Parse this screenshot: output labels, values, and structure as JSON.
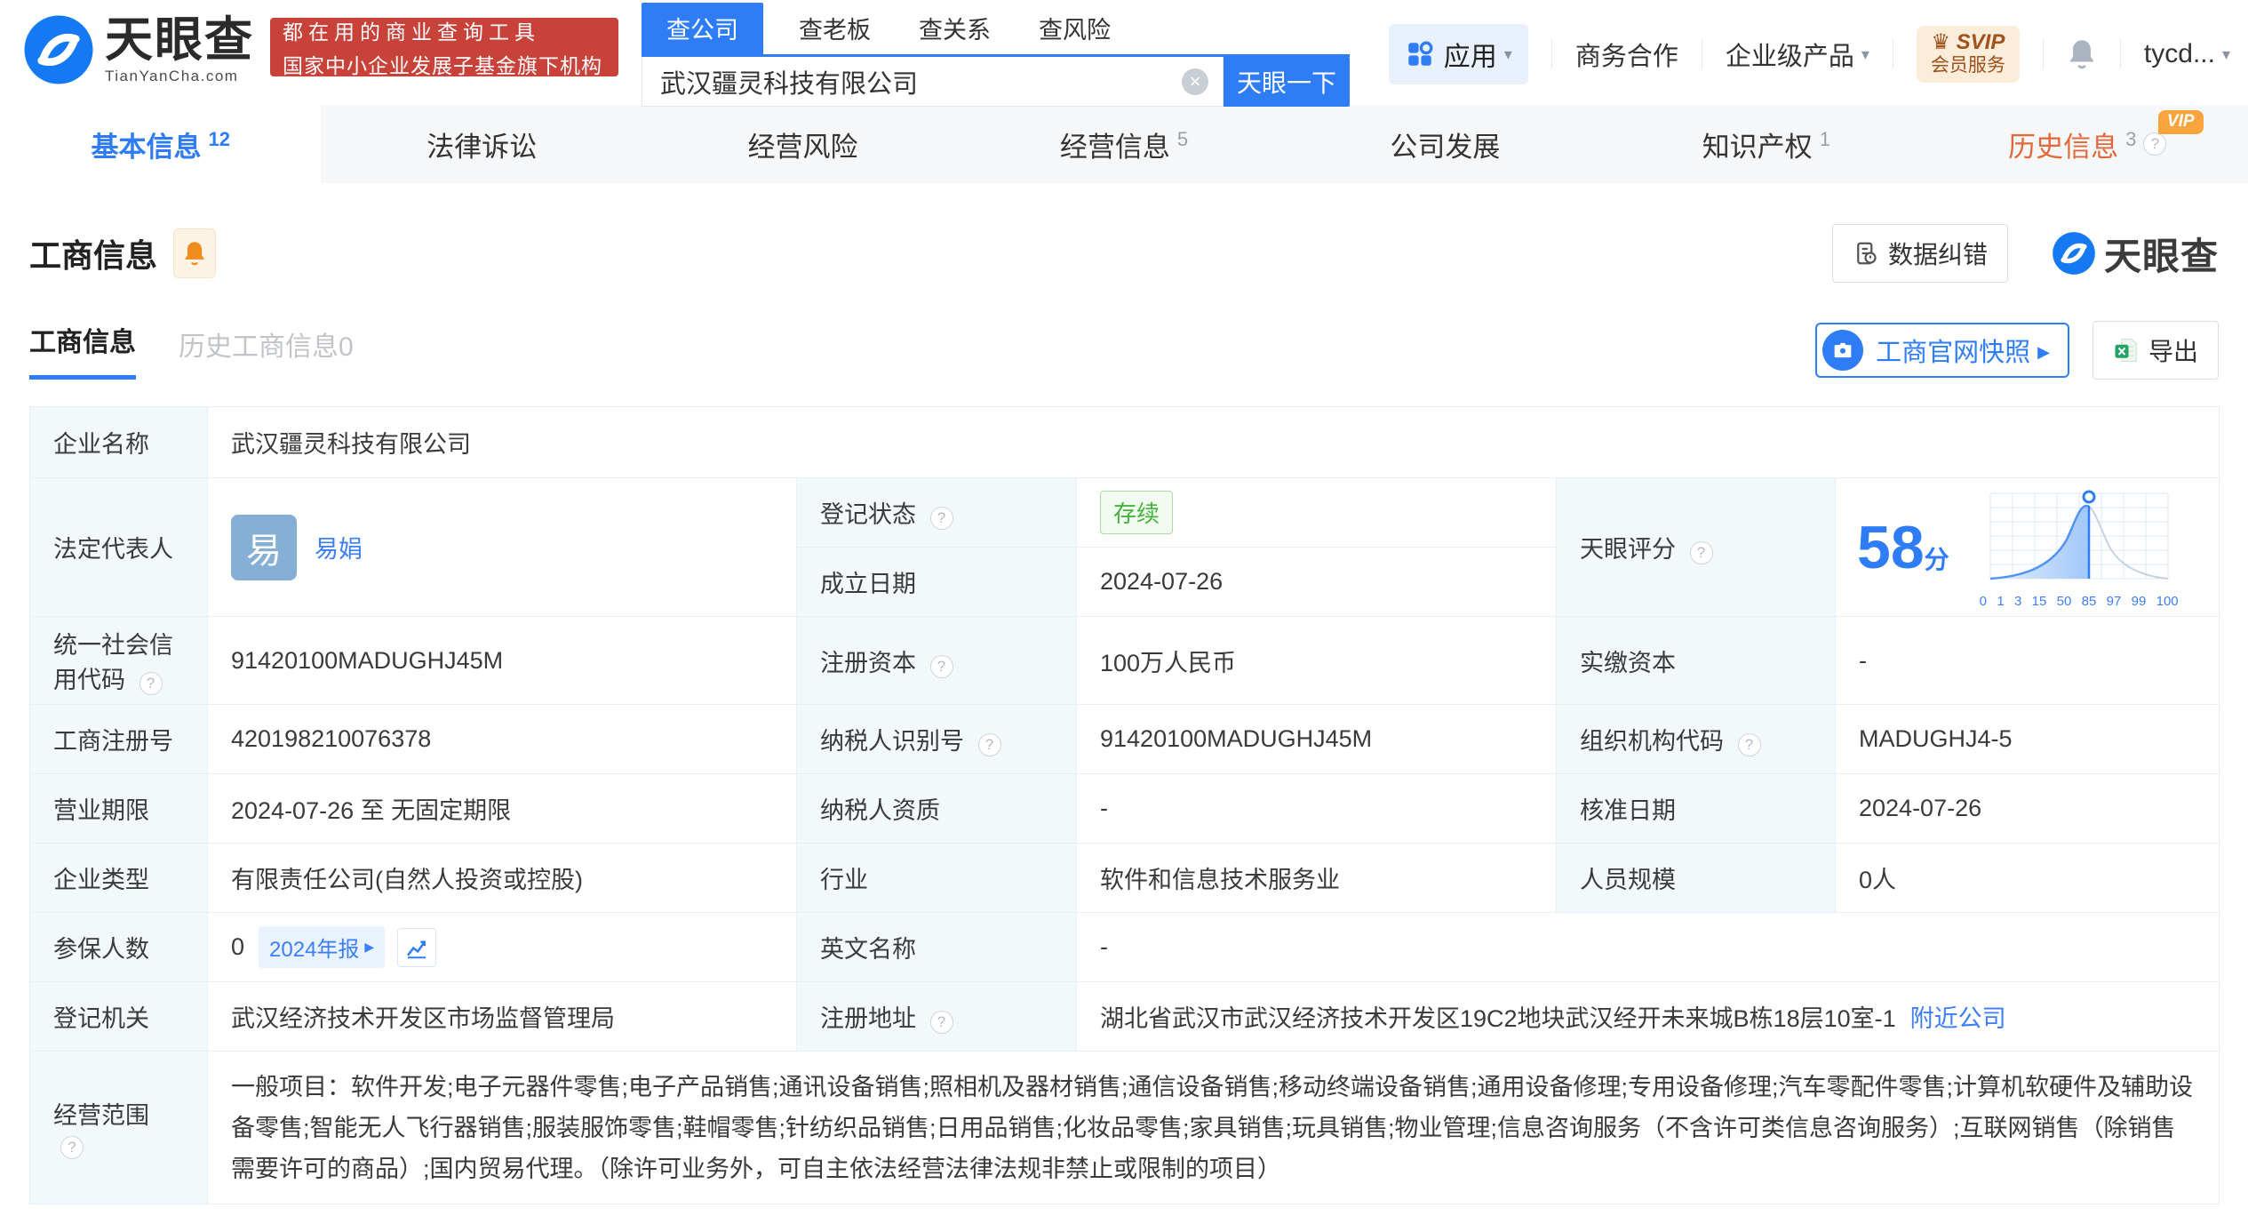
{
  "icons": {
    "help": "?",
    "clear": "×",
    "caret": "▾",
    "play": "▶"
  },
  "vip_badge": "VIP",
  "header": {
    "logo": {
      "brand": "天眼查",
      "domain": "TianYanCha.com"
    },
    "promo": {
      "line1": "都在用的商业查询工具",
      "line2": "国家中小企业发展子基金旗下机构"
    },
    "search": {
      "tabs": [
        {
          "label": "查公司"
        },
        {
          "label": "查老板"
        },
        {
          "label": "查关系"
        },
        {
          "label": "查风险"
        }
      ],
      "value": "武汉疆灵科技有限公司",
      "button": "天眼一下"
    },
    "nav": {
      "apps": "应用",
      "cooperation": "商务合作",
      "enterprise": "企业级产品",
      "svip_line1": "SVIP",
      "svip_line2": "会员服务",
      "user": "tycd..."
    }
  },
  "page_tabs": [
    {
      "label": "基本信息",
      "count": "12"
    },
    {
      "label": "法律诉讼",
      "count": ""
    },
    {
      "label": "经营风险",
      "count": ""
    },
    {
      "label": "经营信息",
      "count": "5"
    },
    {
      "label": "公司发展",
      "count": ""
    },
    {
      "label": "知识产权",
      "count": "1"
    },
    {
      "label": "历史信息",
      "count": "3"
    }
  ],
  "section": {
    "title": "工商信息",
    "correction": "数据纠错",
    "watermark": "天眼查",
    "subtab_active": "工商信息",
    "subtab_history": "历史工商信息0",
    "snapshot": "工商官网快照",
    "export": "导出"
  },
  "table": {
    "company_name": {
      "label": "企业名称",
      "value": "武汉疆灵科技有限公司"
    },
    "legal_rep": {
      "label": "法定代表人",
      "avatar": "易",
      "name": "易娟"
    },
    "reg_status": {
      "label": "登记状态",
      "value": "存续"
    },
    "establish_date": {
      "label": "成立日期",
      "value": "2024-07-26"
    },
    "tyc_score": {
      "label": "天眼评分",
      "score": "58",
      "unit": "分",
      "ticks": [
        "0",
        "1",
        "3",
        "15",
        "50",
        "85",
        "97",
        "99",
        "100"
      ]
    },
    "credit_code": {
      "label": "统一社会信用代码",
      "value": "91420100MADUGHJ45M"
    },
    "reg_capital": {
      "label": "注册资本",
      "value": "100万人民币"
    },
    "paid_capital": {
      "label": "实缴资本",
      "value": "-"
    },
    "reg_number": {
      "label": "工商注册号",
      "value": "420198210076378"
    },
    "taxpayer_id": {
      "label": "纳税人识别号",
      "value": "91420100MADUGHJ45M"
    },
    "org_code": {
      "label": "组织机构代码",
      "value": "MADUGHJ4-5"
    },
    "business_term": {
      "label": "营业期限",
      "value": "2024-07-26 至 无固定期限"
    },
    "taxpayer_quality": {
      "label": "纳税人资质",
      "value": "-"
    },
    "approval_date": {
      "label": "核准日期",
      "value": "2024-07-26"
    },
    "company_type": {
      "label": "企业类型",
      "value": "有限责任公司(自然人投资或控股)"
    },
    "industry": {
      "label": "行业",
      "value": "软件和信息技术服务业"
    },
    "staff_size": {
      "label": "人员规模",
      "value": "0人"
    },
    "insured_count": {
      "label": "参保人数",
      "value": "0",
      "badge": "2024年报"
    },
    "english_name": {
      "label": "英文名称",
      "value": "-"
    },
    "reg_authority": {
      "label": "登记机关",
      "value": "武汉经济技术开发区市场监督管理局"
    },
    "reg_address": {
      "label": "注册地址",
      "value": "湖北省武汉市武汉经济技术开发区19C2地块武汉经开未来城B栋18层10室-1",
      "link": "附近公司"
    },
    "business_scope": {
      "label": "经营范围",
      "value": "一般项目：软件开发;电子元器件零售;电子产品销售;通讯设备销售;照相机及器材销售;通信设备销售;移动终端设备销售;通用设备修理;专用设备修理;汽车零配件零售;计算机软硬件及辅助设备零售;智能无人飞行器销售;服装服饰零售;鞋帽零售;针纺织品销售;日用品销售;化妆品零售;家具销售;玩具销售;物业管理;信息咨询服务（不含许可类信息咨询服务）;互联网销售（除销售需要许可的商品）;国内贸易代理。（除许可业务外，可自主依法经营法律法规非禁止或限制的项目）"
    }
  }
}
